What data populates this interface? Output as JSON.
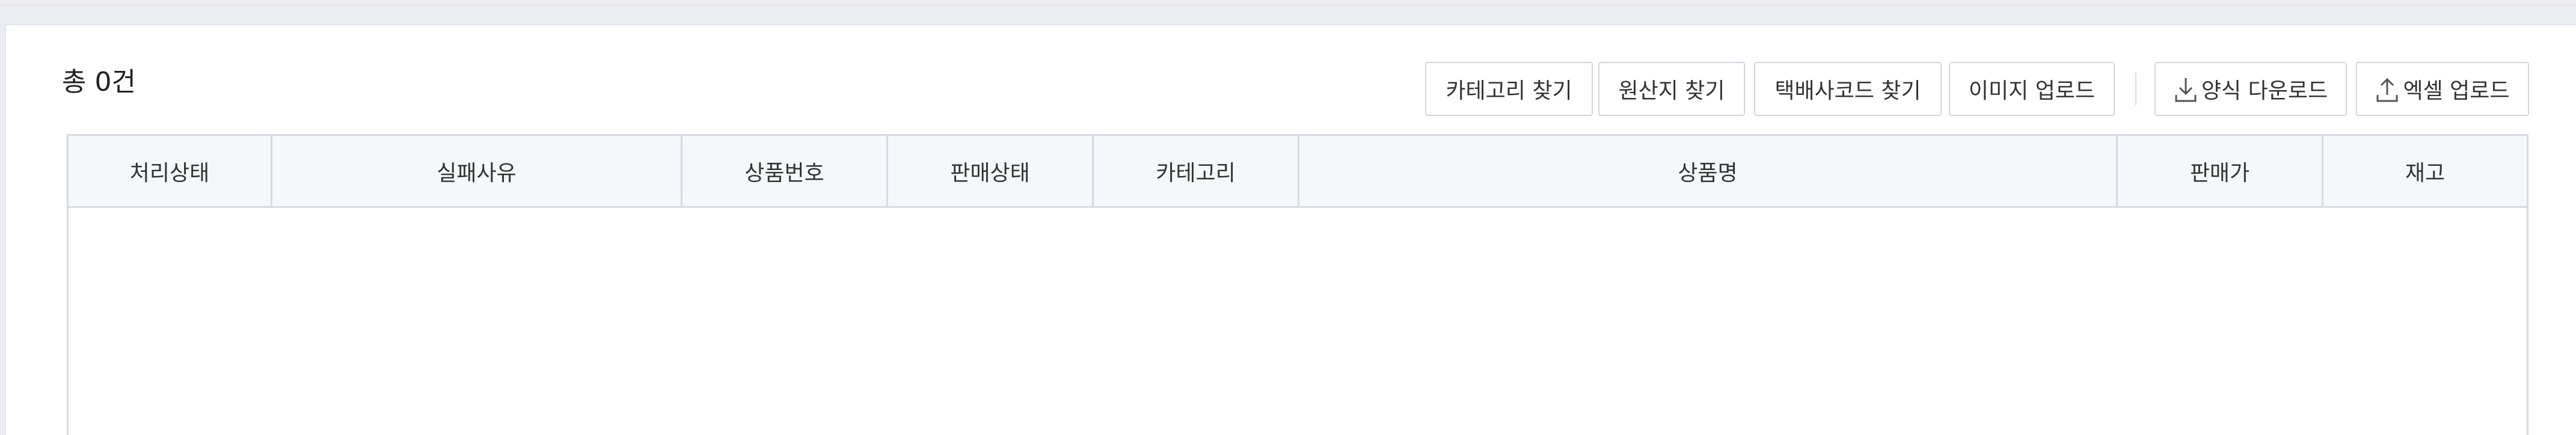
{
  "summary": {
    "total_label": "총 0건"
  },
  "toolbar": {
    "find_category": "카테고리 찾기",
    "find_origin": "원산지 찾기",
    "find_courier_code": "택배사코드 찾기",
    "image_upload": "이미지 업로드",
    "form_download": "양식 다운로드",
    "excel_upload": "엑셀 업로드"
  },
  "table": {
    "columns": [
      "처리상태",
      "실패사유",
      "상품번호",
      "판매상태",
      "카테고리",
      "상품명",
      "판매가",
      "재고"
    ],
    "rows": []
  },
  "icons": {
    "download": "download-icon",
    "upload": "upload-icon"
  },
  "colors": {
    "border": "#d7dae2",
    "header_bg": "#f6f7fb",
    "page_bg": "#ecedf2"
  }
}
